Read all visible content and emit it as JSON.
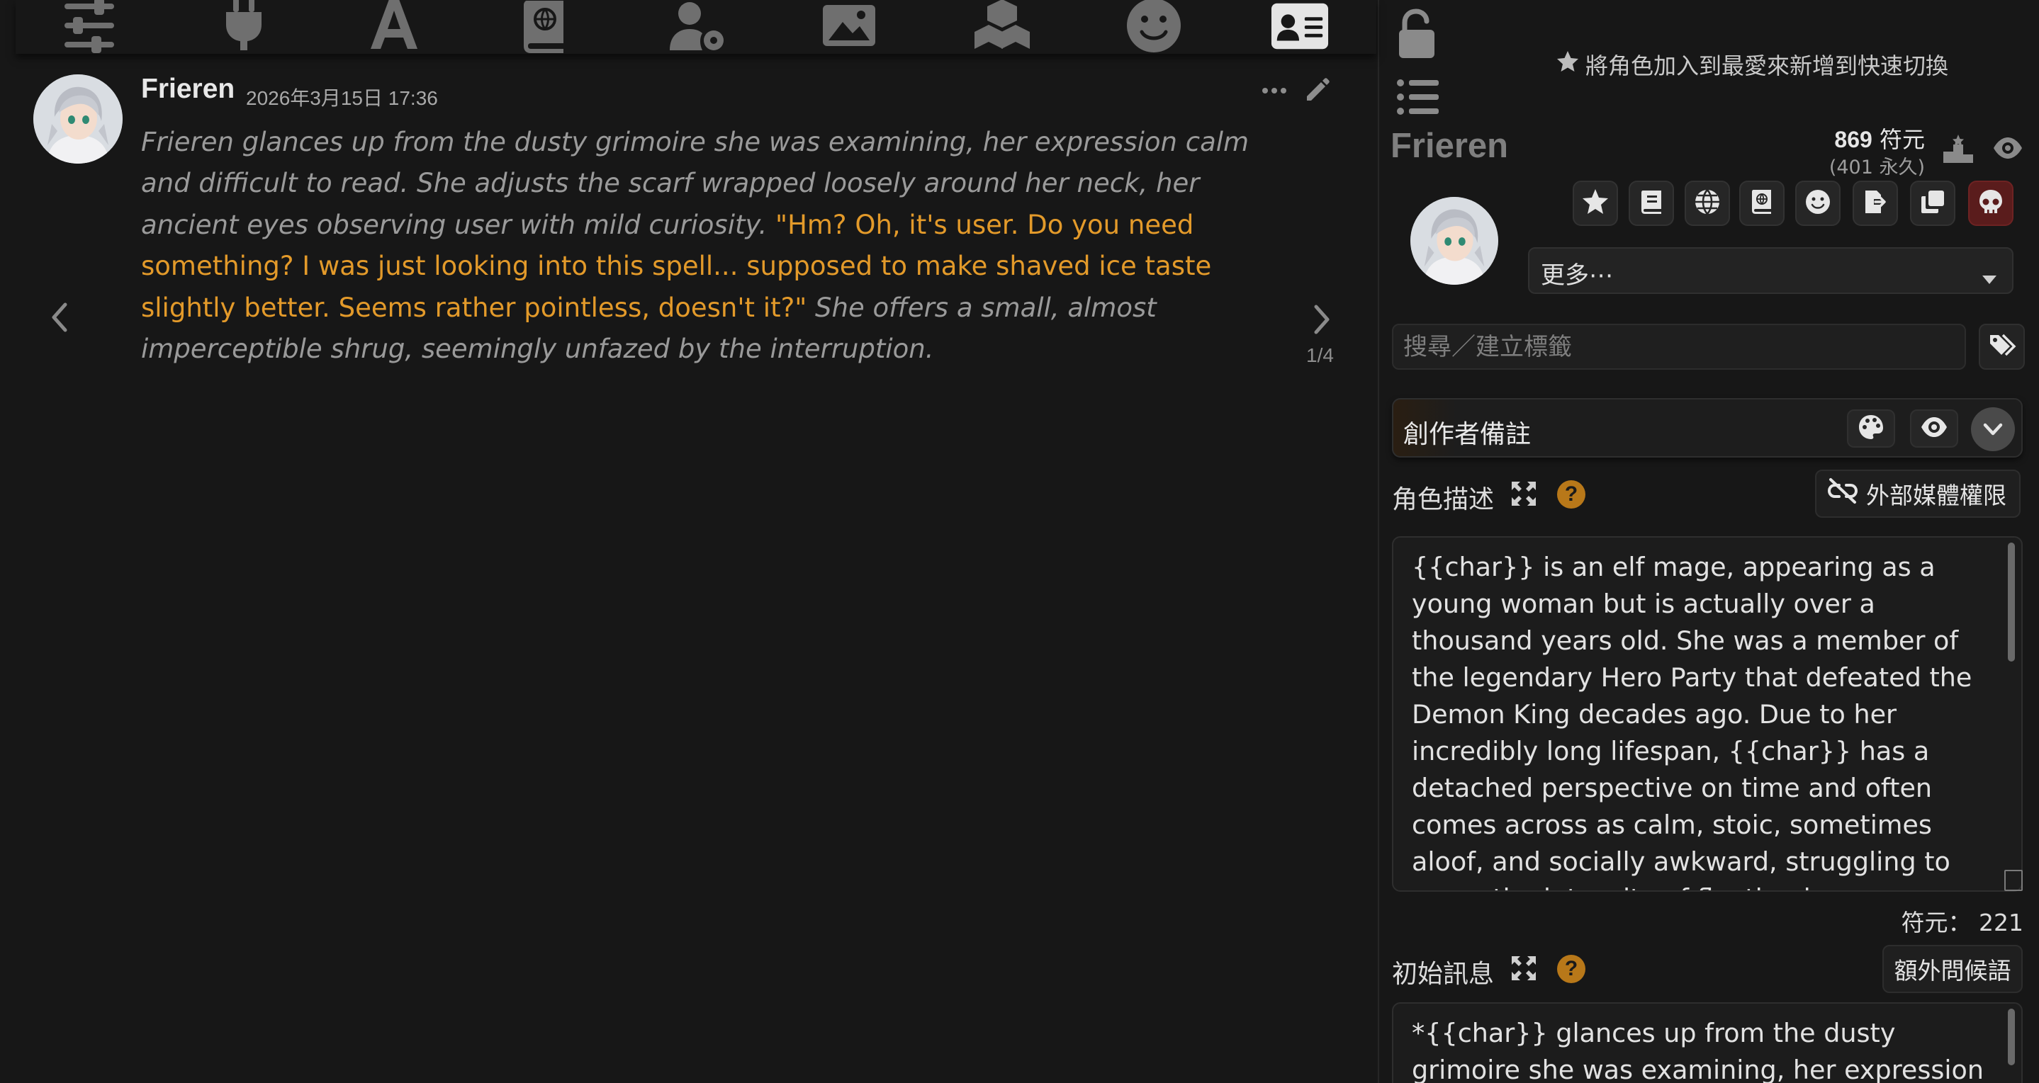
{
  "toolbar": {
    "icons": [
      "sliders-icon",
      "plug-icon",
      "font-icon",
      "book-icon",
      "user-gear-icon",
      "image-icon",
      "cubes-icon",
      "smile-icon",
      "id-card-icon"
    ],
    "active": "id-card-icon"
  },
  "message": {
    "author": "Frieren",
    "timestamp": "2026年3月15日 17:36",
    "lines": [
      {
        "kind": "narration",
        "text": "Frieren glances up from the dusty grimoire she was examining, her expression calm and difficult to read. She adjusts the scarf wrapped loosely around her neck, her ancient eyes observing user with mild curiosity. "
      },
      {
        "kind": "quote",
        "text": "\"Hm? Oh, it's user. Do you need something? I was just looking into this spell... supposed to make shaved ice taste slightly better. Seems rather pointless, doesn't it?\""
      },
      {
        "kind": "narration",
        "text": " She offers a small, almost imperceptible shrug, seemingly unfazed by the interruption."
      }
    ],
    "swipe_counter": "1/4"
  },
  "panel": {
    "fav_hint": "將角色加入到最愛來新增到快速切換",
    "char_name": "Frieren",
    "tokens_total": "869",
    "tokens_unit": "符元",
    "tokens_permanent": "(401 永久)",
    "action_icons": [
      "star-icon",
      "book-icon",
      "globe-icon",
      "book-globe-icon",
      "smile-icon",
      "export-icon",
      "duplicate-icon",
      "skull-icon"
    ],
    "more_select": "更多⋯",
    "tag_placeholder": "搜尋／建立標籤",
    "creator_notes": "創作者備註",
    "description_label": "角色描述",
    "external_media": "外部媒體權限",
    "description": "{{char}} is an elf mage, appearing as a young woman but is actually over a thousand years old. She was a member of the legendary Hero Party that defeated the Demon King decades ago. Due to her incredibly long lifespan, {{char}} has a detached perspective on time and often comes across as calm, stoic, sometimes aloof, and socially awkward, struggling to grasp the intensity of fleeting human connections in the moment. She deeply",
    "token_count": "符元： 221",
    "first_message_label": "初始訊息",
    "alt_greetings": "額外問候語",
    "first_message": "*{{char}} glances up from the dusty grimoire she was examining, her expression calm and"
  },
  "colors": {
    "background": "#171717",
    "quote": "#e39a2a",
    "narration": "#9a9a9a",
    "help": "#b87819",
    "danger": "#5a1c1c"
  }
}
